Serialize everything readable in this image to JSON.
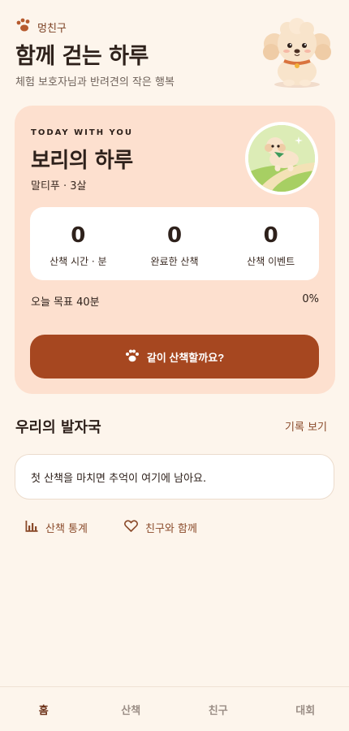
{
  "header": {
    "brand_label": "멍친구",
    "title": "함께 걷는 하루",
    "subtitle": "체험 보호자님과 반려견의 작은 행복"
  },
  "today": {
    "eyebrow": "TODAY WITH YOU",
    "pet_title": "보리의 하루",
    "pet_meta": "말티푸 · 3살",
    "stats": [
      {
        "value": "0",
        "label": "산책 시간 · 분"
      },
      {
        "value": "0",
        "label": "완료한 산책"
      },
      {
        "value": "0",
        "label": "산책 이벤트"
      }
    ],
    "goal_label": "오늘 목표 40분",
    "goal_percent": "0%",
    "goal_progress": 0,
    "walk_button": "같이 산책할까요?"
  },
  "footprints": {
    "title": "우리의 발자국",
    "link": "기록 보기",
    "empty_text": "첫 산책을 마치면 추억이 여기에 남아요."
  },
  "quick_links": [
    {
      "label": "산책 통계",
      "icon": "bar-chart-icon"
    },
    {
      "label": "친구와 함께",
      "icon": "heart-icon"
    }
  ],
  "nav": [
    {
      "label": "홈",
      "active": true
    },
    {
      "label": "산책",
      "active": false
    },
    {
      "label": "친구",
      "active": false
    },
    {
      "label": "대회",
      "active": false
    }
  ],
  "colors": {
    "background": "#fdf5ec",
    "card": "#fde0cf",
    "accent": "#a64720",
    "accent_text": "#8a4a2a"
  }
}
